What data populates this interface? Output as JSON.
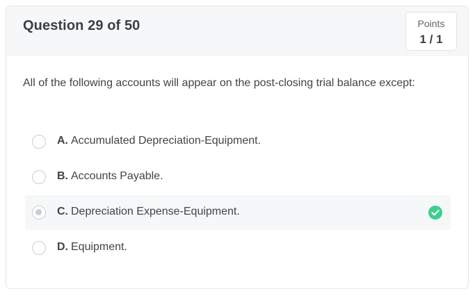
{
  "header": {
    "question_title": "Question 29 of 50",
    "points_label": "Points",
    "points_value": "1 / 1"
  },
  "question": {
    "prompt": "All of the following accounts will appear on the post-closing trial balance except:"
  },
  "options": [
    {
      "letter": "A.",
      "text": "Accumulated Depreciation-Equipment.",
      "selected": false,
      "correct": false
    },
    {
      "letter": "B.",
      "text": "Accounts Payable.",
      "selected": false,
      "correct": false
    },
    {
      "letter": "C.",
      "text": "Depreciation Expense-Equipment.",
      "selected": true,
      "correct": true
    },
    {
      "letter": "D.",
      "text": "Equipment.",
      "selected": false,
      "correct": false
    }
  ],
  "icons": {
    "correct_indicator": "check-circle-icon"
  },
  "colors": {
    "correct_green": "#3ecf8e",
    "header_bg": "#f6f7f8",
    "text": "#3f444a"
  }
}
